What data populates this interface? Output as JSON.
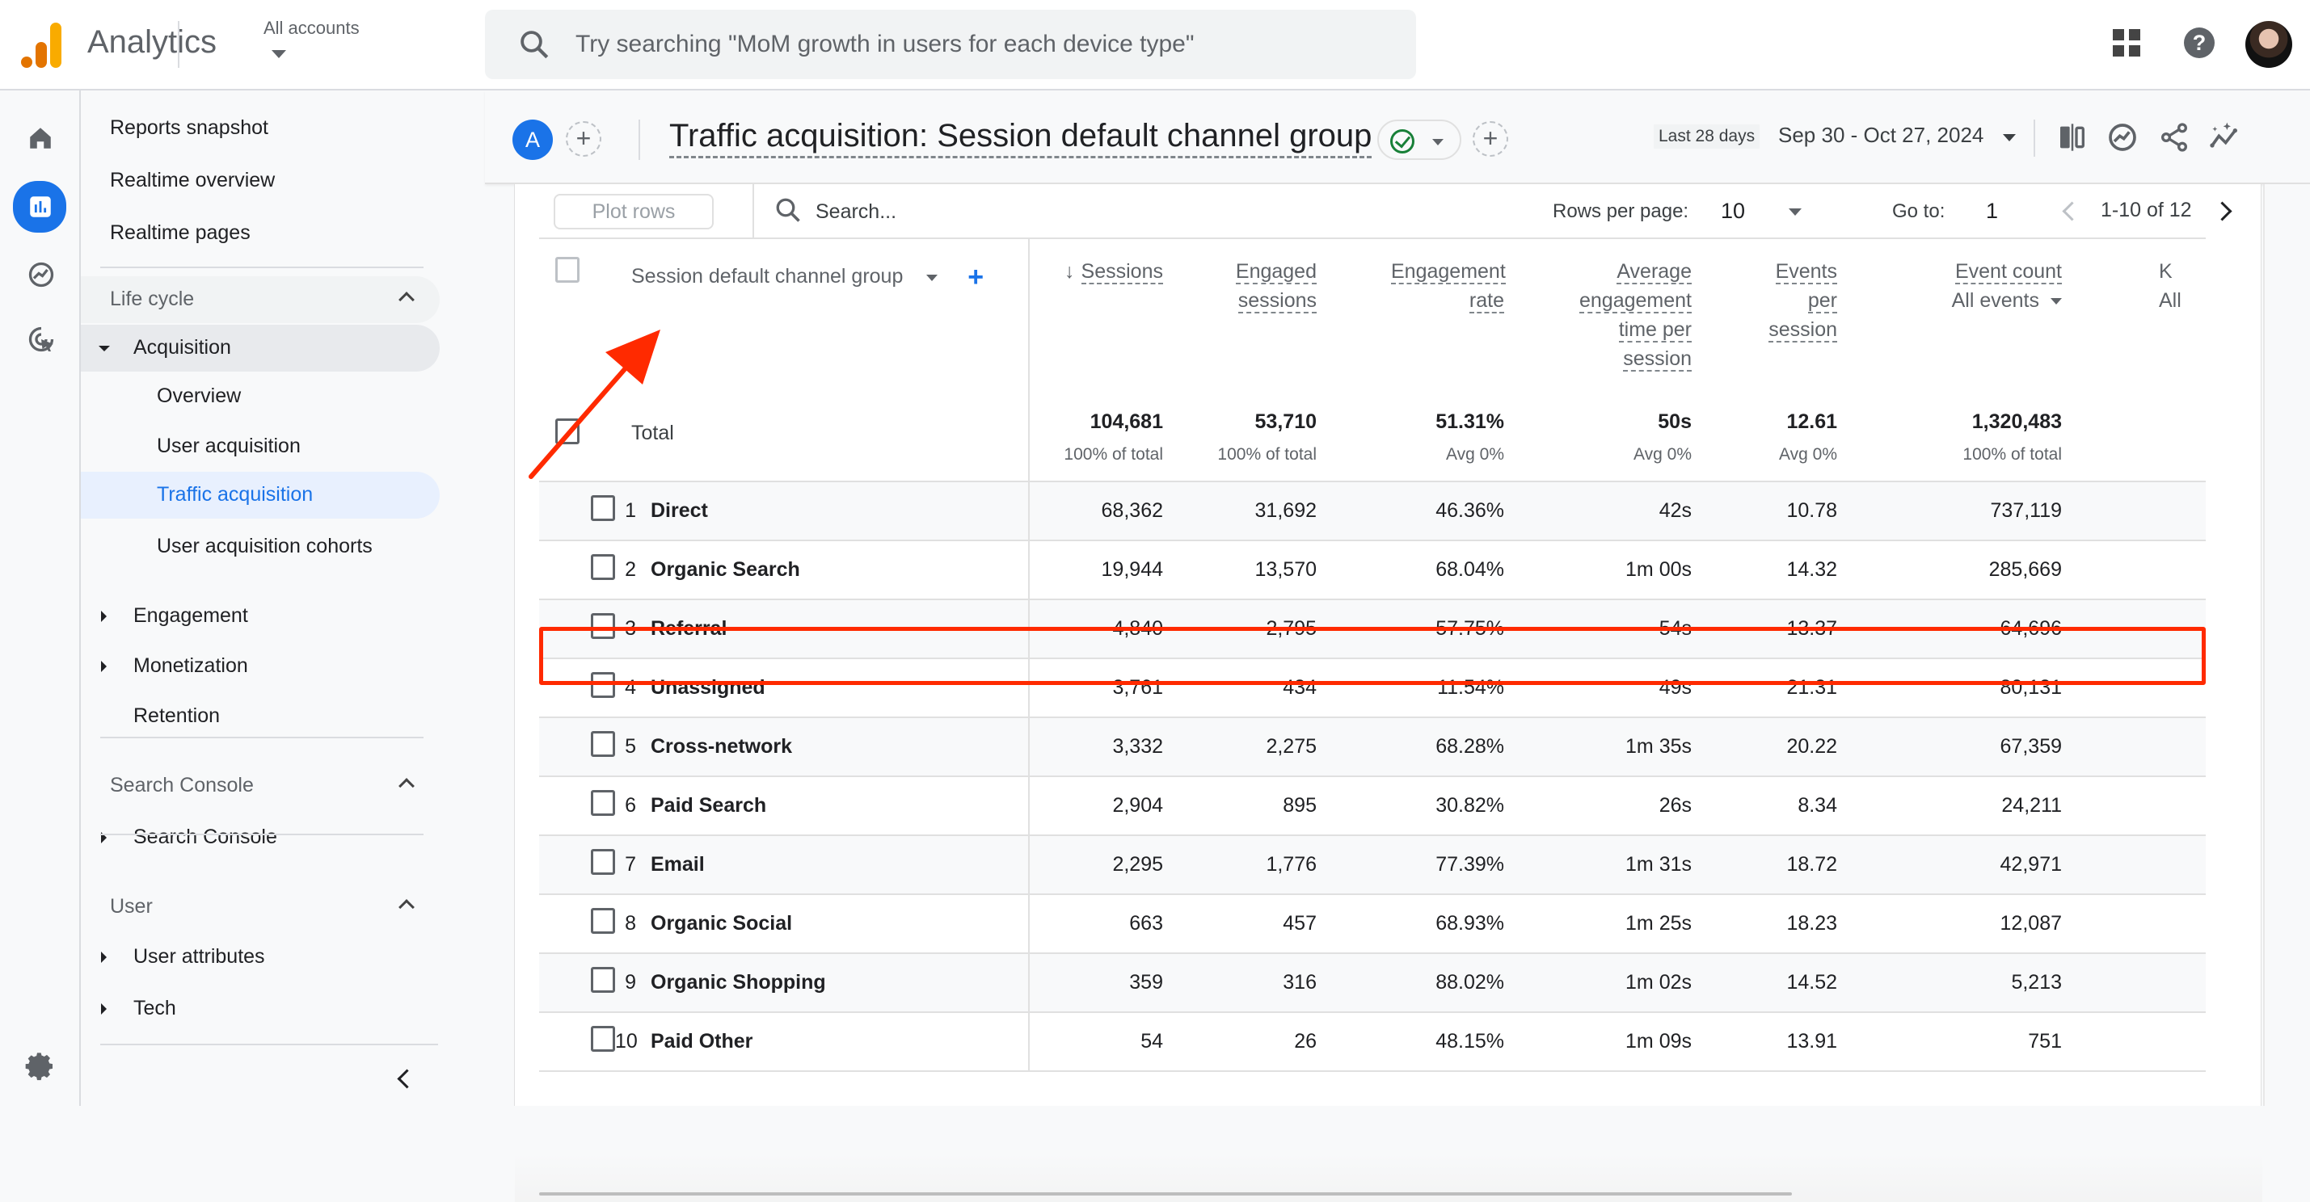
{
  "app": {
    "name": "Analytics",
    "account_selector": "All accounts",
    "search_placeholder": "Try searching \"MoM growth in users for each device type\"",
    "brand_colors": {
      "logo_dark": "#e37400",
      "logo_light": "#f9ab00",
      "accent": "#1a73e8",
      "highlight": "#ff2a00"
    }
  },
  "topbar_icons": [
    "apps-grid-icon",
    "help-icon",
    "avatar"
  ],
  "rail": [
    {
      "name": "home",
      "icon": "home-icon",
      "active": false
    },
    {
      "name": "reports",
      "icon": "bar-chart-icon",
      "active": true
    },
    {
      "name": "explore",
      "icon": "explore-icon",
      "active": false
    },
    {
      "name": "advertising",
      "icon": "advertising-icon",
      "active": false
    }
  ],
  "nav": {
    "top_items": [
      "Reports snapshot",
      "Realtime overview",
      "Realtime pages"
    ],
    "lifecycle": {
      "label": "Life cycle",
      "acquisition": "Acquisition",
      "acquisition_children": [
        "Overview",
        "User acquisition",
        "Traffic acquisition",
        "User acquisition cohorts"
      ],
      "active_child": "Traffic acquisition",
      "others": [
        "Engagement",
        "Monetization",
        "Retention"
      ]
    },
    "search_console": {
      "label": "Search Console",
      "items": [
        "Search Console"
      ]
    },
    "user": {
      "label": "User",
      "items": [
        "User attributes",
        "Tech"
      ]
    }
  },
  "report": {
    "segment_badge": "A",
    "title": "Traffic acquisition: Session default channel group",
    "date_label": "Last 28 days",
    "date_range": "Sep 30 - Oct 27, 2024",
    "tool_icons": [
      "compare-icon",
      "insights-icon",
      "share-icon",
      "spark-icon"
    ]
  },
  "table_toolbar": {
    "plot_rows": "Plot rows",
    "search_placeholder": "Search...",
    "rows_per_page_label": "Rows per page:",
    "rows_per_page": "10",
    "goto_label": "Go to:",
    "goto_value": "1",
    "pagination": "1-10 of 12"
  },
  "table": {
    "dimension_header": "Session default channel group",
    "columns": [
      {
        "label": "Sessions",
        "sorted": "desc"
      },
      {
        "label": "Engaged sessions"
      },
      {
        "label": "Engagement rate"
      },
      {
        "label": "Average engagement time per session"
      },
      {
        "label": "Events per session"
      },
      {
        "label": "Event count",
        "sub": "All events"
      },
      {
        "label": "K",
        "sub": "All"
      }
    ],
    "total": {
      "label": "Total",
      "values": [
        "104,681",
        "53,710",
        "51.31%",
        "50s",
        "12.61",
        "1,320,483"
      ],
      "subs": [
        "100% of total",
        "100% of total",
        "Avg 0%",
        "Avg 0%",
        "Avg 0%",
        "100% of total"
      ]
    },
    "rows": [
      {
        "idx": "1",
        "name": "Direct",
        "values": [
          "68,362",
          "31,692",
          "46.36%",
          "42s",
          "10.78",
          "737,119"
        ]
      },
      {
        "idx": "2",
        "name": "Organic Search",
        "values": [
          "19,944",
          "13,570",
          "68.04%",
          "1m 00s",
          "14.32",
          "285,669"
        ],
        "highlighted": true
      },
      {
        "idx": "3",
        "name": "Referral",
        "values": [
          "4,840",
          "2,795",
          "57.75%",
          "54s",
          "13.37",
          "64,696"
        ]
      },
      {
        "idx": "4",
        "name": "Unassigned",
        "values": [
          "3,761",
          "434",
          "11.54%",
          "49s",
          "21.31",
          "80,131"
        ]
      },
      {
        "idx": "5",
        "name": "Cross-network",
        "values": [
          "3,332",
          "2,275",
          "68.28%",
          "1m 35s",
          "20.22",
          "67,359"
        ]
      },
      {
        "idx": "6",
        "name": "Paid Search",
        "values": [
          "2,904",
          "895",
          "30.82%",
          "26s",
          "8.34",
          "24,211"
        ]
      },
      {
        "idx": "7",
        "name": "Email",
        "values": [
          "2,295",
          "1,776",
          "77.39%",
          "1m 31s",
          "18.72",
          "42,971"
        ]
      },
      {
        "idx": "8",
        "name": "Organic Social",
        "values": [
          "663",
          "457",
          "68.93%",
          "1m 25s",
          "18.23",
          "12,087"
        ]
      },
      {
        "idx": "9",
        "name": "Organic Shopping",
        "values": [
          "359",
          "316",
          "88.02%",
          "1m 02s",
          "14.52",
          "5,213"
        ]
      },
      {
        "idx": "10",
        "name": "Paid Other",
        "values": [
          "54",
          "26",
          "48.15%",
          "1m 09s",
          "13.91",
          "751"
        ]
      }
    ]
  }
}
